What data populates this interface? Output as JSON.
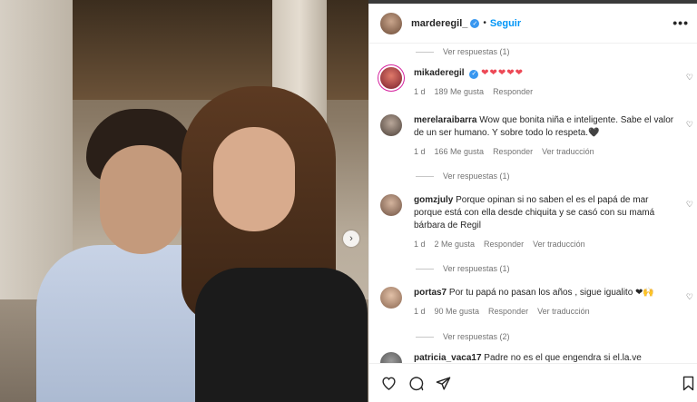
{
  "post": {
    "username": "marderegil_",
    "follow_label": "Seguir",
    "dot": "•",
    "more_label": "•••"
  },
  "comments": [
    {
      "replies_label": "Ver respuestas (1)"
    },
    {
      "username": "mikaderegil",
      "verified": true,
      "text": "",
      "hearts": "❤❤❤❤❤",
      "time": "1 d",
      "likes": "189 Me gusta",
      "reply_label": "Responder",
      "translate_label": ""
    },
    {
      "username": "merelaraibarra",
      "text": "Wow que bonita niña e inteligente. Sabe el valor de un ser humano. Y sobre todo lo respeta.🖤",
      "time": "1 d",
      "likes": "166 Me gusta",
      "reply_label": "Responder",
      "translate_label": "Ver traducción",
      "replies_label": "Ver respuestas (1)"
    },
    {
      "username": "gomzjuly",
      "text": "Porque opinan si no saben el es el papá de mar porque está con ella desde chiquita y se casó con su mamá bárbara de Regil",
      "time": "1 d",
      "likes": "2 Me gusta",
      "reply_label": "Responder",
      "translate_label": "Ver traducción",
      "replies_label": "Ver respuestas (1)"
    },
    {
      "username": "portas7",
      "text": "Por tu papá no pasan los años , sigue igualito ❤🙌",
      "time": "1 d",
      "likes": "90 Me gusta",
      "reply_label": "Responder",
      "translate_label": "Ver traducción",
      "replies_label": "Ver respuestas (2)"
    },
    {
      "username": "patricia_vaca17",
      "text": "Padre no es el que engendra si el.la.ve"
    }
  ],
  "icons": {
    "like": "heart-icon",
    "comment": "comment-icon",
    "share": "share-icon",
    "save": "bookmark-icon",
    "next": "chevron-right-icon"
  },
  "colors": {
    "accent": "#0095f6",
    "verified": "#3897f0",
    "heart": "#ed4956"
  }
}
